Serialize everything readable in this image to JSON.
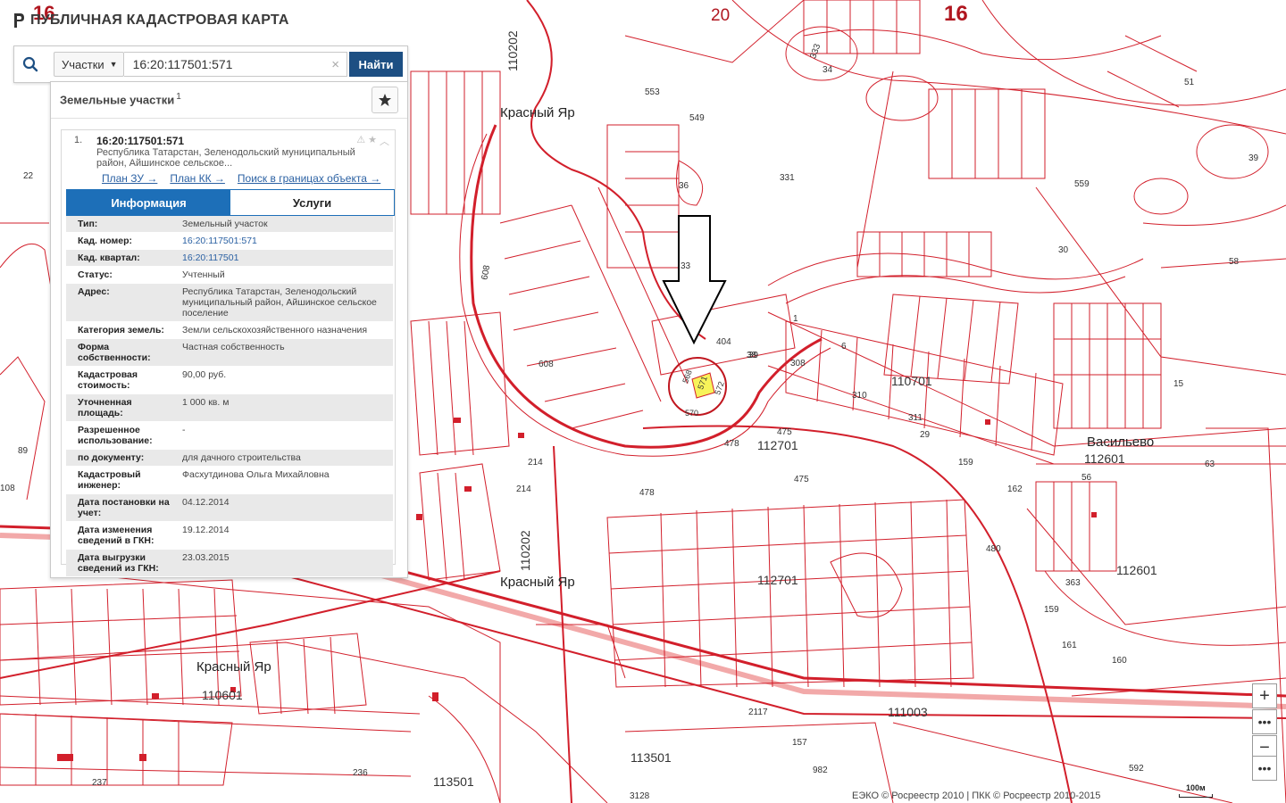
{
  "app": {
    "title": "ПУБЛИЧНАЯ КАДАСТРОВАЯ КАРТА",
    "logo_icon": "rosreestr-logo-icon"
  },
  "search": {
    "icon": "search-icon",
    "category": "Участки",
    "value": "16:20:117501:571",
    "button": "Найти"
  },
  "panel": {
    "title": "Земельные участки",
    "count": "1",
    "result": {
      "index": "1.",
      "cadastral_number": "16:20:117501:571",
      "address_short": "Республика Татарстан, Зеленодольский муниципальный район, Айшинское сельское...",
      "links": [
        "План ЗУ →",
        "План КК →",
        "Поиск в границах объекта →"
      ]
    },
    "tabs": [
      "Информация",
      "Услуги"
    ],
    "attributes": [
      {
        "key": "Тип:",
        "value": "Земельный участок"
      },
      {
        "key": "Кад. номер:",
        "value": "16:20:117501:571"
      },
      {
        "key": "Кад. квартал:",
        "value": "16:20:117501"
      },
      {
        "key": "Статус:",
        "value": "Учтенный"
      },
      {
        "key": "Адрес:",
        "value": "Республика Татарстан, Зеленодольский муниципальный район, Айшинское сельское поселение"
      },
      {
        "key": "Категория земель:",
        "value": "Земли сельскохозяйственного назначения"
      },
      {
        "key": "Форма собственности:",
        "value": "Частная собственность"
      },
      {
        "key": "Кадастровая стоимость:",
        "value": "90,00 руб."
      },
      {
        "key": "Уточненная площадь:",
        "value": "1 000 кв. м"
      },
      {
        "key": "Разрешенное использование:",
        "value": "-"
      },
      {
        "key": "по документу:",
        "value": "для дачного строительства"
      },
      {
        "key": "Кадастровый инженер:",
        "value": "Фасхутдинова Ольга Михайловна"
      },
      {
        "key": "Дата постановки на учет:",
        "value": "04.12.2014"
      },
      {
        "key": "Дата изменения сведений в ГКН:",
        "value": "19.12.2014"
      },
      {
        "key": "Дата выгрузки сведений из ГКН:",
        "value": "23.03.2015"
      }
    ]
  },
  "map": {
    "places": [
      "Красный Яр",
      "Красный Яр",
      "Красный Яр",
      "Васильево"
    ],
    "district_codes": [
      "16",
      "16",
      "20"
    ],
    "quarters": [
      "110202",
      "110701",
      "112701",
      "112701",
      "112601",
      "112601",
      "110601",
      "111003",
      "113501",
      "113501",
      "110202"
    ],
    "parcels": [
      "553",
      "549",
      "331",
      "559",
      "58",
      "608",
      "608",
      "478",
      "478",
      "475",
      "475",
      "214",
      "214",
      "480",
      "363",
      "159",
      "161",
      "160",
      "236",
      "237",
      "2117",
      "29",
      "30",
      "39",
      "51",
      "1",
      "6",
      "15",
      "308",
      "310",
      "311",
      "39",
      "162",
      "159",
      "63",
      "56",
      "22",
      "89",
      "108",
      "3128",
      "982",
      "157",
      "592",
      "571",
      "568",
      "570",
      "572",
      "33",
      "36",
      "404",
      "38",
      "34",
      "333"
    ],
    "target_parcel": "571",
    "target_color": "#f7f35a",
    "line_color": "#d21f2b"
  },
  "controls": {
    "zoom_in": "+",
    "more": "•••",
    "zoom_out": "−",
    "menu": "•••"
  },
  "copyright": "ЕЭКО © Росреестр 2010 | ПКК © Росреестр 2010-2015",
  "scale": "100м"
}
